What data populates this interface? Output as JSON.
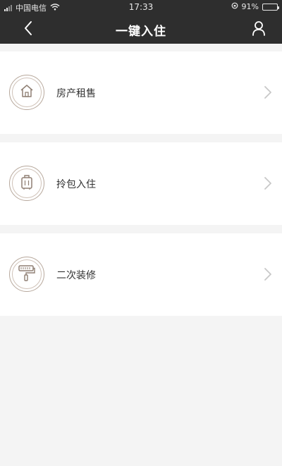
{
  "status_bar": {
    "carrier": "中国电信",
    "time": "17:33",
    "battery": "91%",
    "battery_level": 0.91
  },
  "header": {
    "title": "一键入住",
    "back_icon": "chevron-left-icon",
    "user_icon": "user-icon"
  },
  "menu": [
    {
      "label": "房产租售",
      "icon": "house-icon"
    },
    {
      "label": "拎包入住",
      "icon": "luggage-icon"
    },
    {
      "label": "二次装修",
      "icon": "paint-roller-icon"
    }
  ],
  "colors": {
    "header_bg": "#2e2e2e",
    "icon_accent": "#b7a89c",
    "page_bg": "#f4f4f4"
  }
}
